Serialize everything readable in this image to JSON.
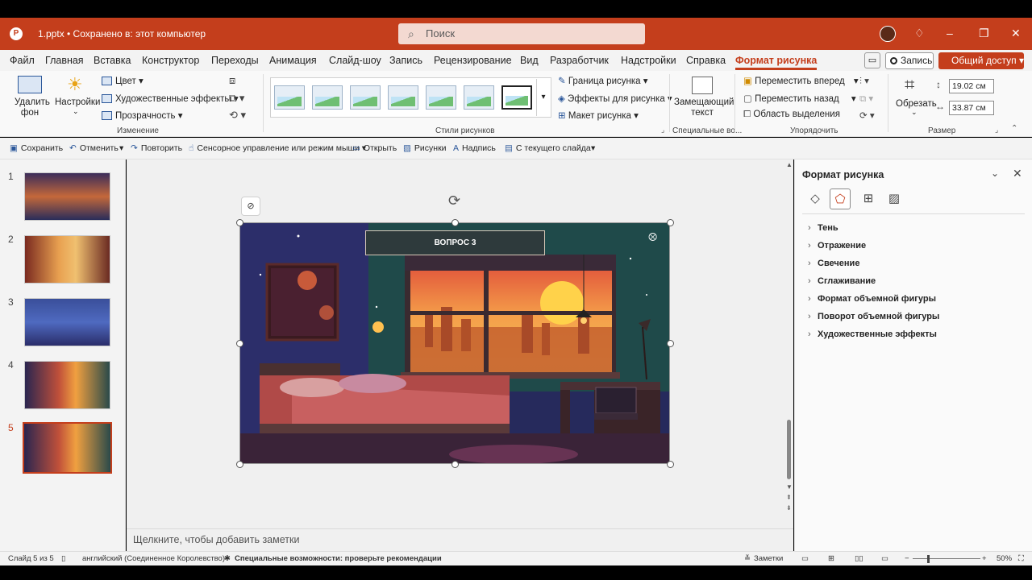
{
  "titlebar": {
    "doc_title": "1.pptx • Сохранено в: этот компьютер",
    "search_placeholder": "Поиск"
  },
  "tabs": [
    "Файл",
    "Главная",
    "Вставка",
    "Конструктор",
    "Переходы",
    "Анимация",
    "Слайд-шоу",
    "Запись",
    "Рецензирование",
    "Вид",
    "Разработчик",
    "Надстройки",
    "Справка",
    "Формат рисунка"
  ],
  "actions": {
    "record": "Запись",
    "share": "Общий доступ"
  },
  "ribbon": {
    "remove_bg": "Удалить фон",
    "corrections": "Настройки",
    "color": "Цвет",
    "artistic": "Художественные эффекты",
    "transparency": "Прозрачность",
    "group_change": "Изменение",
    "group_styles": "Стили рисунков",
    "border": "Граница рисунка",
    "effects": "Эффекты для рисунка",
    "layout": "Макет рисунка",
    "alt_text": "Замещающий текст",
    "group_access": "Специальные во...",
    "bring_forward": "Переместить вперед",
    "send_backward": "Переместить назад",
    "selection_pane": "Область выделения",
    "group_arrange": "Упорядочить",
    "crop": "Обрезать",
    "height": "19.02 см",
    "width": "33.87 см",
    "group_size": "Размер"
  },
  "qat": {
    "save": "Сохранить",
    "undo": "Отменить",
    "redo": "Повторить",
    "touch": "Сенсорное управление или режим мыши",
    "open": "Открыть",
    "pictures": "Рисунки",
    "caption": "Надпись",
    "from_slide": "С текущего слайда"
  },
  "slides": [
    "1",
    "2",
    "3",
    "4",
    "5"
  ],
  "slide": {
    "title": "ВОПРОС 3"
  },
  "notes_placeholder": "Щелкните, чтобы добавить заметки",
  "pane": {
    "title": "Формат рисунка",
    "items": [
      "Тень",
      "Отражение",
      "Свечение",
      "Сглаживание",
      "Формат объемной фигуры",
      "Поворот объемной фигуры",
      "Художественные эффекты"
    ]
  },
  "status": {
    "slide_counter": "Слайд 5 из 5",
    "language": "английский (Соединенное Королевство)",
    "accessibility": "Специальные возможности: проверьте рекомендации",
    "notes": "Заметки",
    "zoom": "50%"
  },
  "colors": {
    "accent": "#c43e1c"
  }
}
